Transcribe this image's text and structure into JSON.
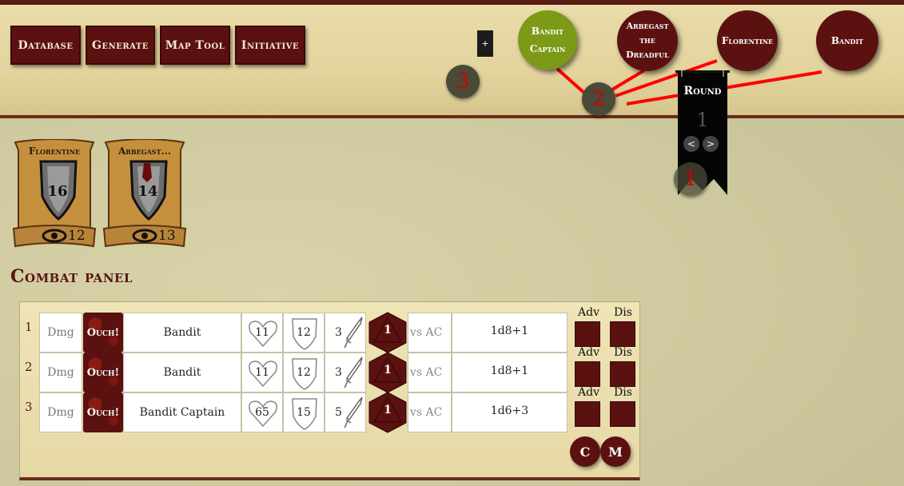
{
  "nav": {
    "database": "Database",
    "generate": "Generate",
    "map_tool": "Map Tool",
    "initiative": "Initiative"
  },
  "add_button": "+",
  "orbs": {
    "a": "3",
    "b": "2",
    "c": "1"
  },
  "tokens": [
    {
      "label": "Bandit Captain",
      "color": "#7d9a17"
    },
    {
      "label": "Arbegast the Dreadful",
      "color": "#5b1110"
    },
    {
      "label": "Florentine",
      "color": "#5b1110"
    },
    {
      "label": "Bandit",
      "color": "#5b1110"
    }
  ],
  "round": {
    "label": "Round",
    "value": "1",
    "prev": "<",
    "next": ">"
  },
  "players": [
    {
      "name": "Florentine",
      "ac": "16",
      "perception": "12"
    },
    {
      "name": "Arbegast...",
      "ac": "14",
      "perception": "13"
    }
  ],
  "combat_title": "Combat panel",
  "rows": [
    {
      "num": "1",
      "dmg": "Dmg",
      "ouch": "Ouch!",
      "name": "Bandit",
      "hp": "11",
      "ac": "12",
      "atk": "3",
      "die": "1",
      "vs": "vs AC",
      "dmg_roll": "1d8+1"
    },
    {
      "num": "2",
      "dmg": "Dmg",
      "ouch": "Ouch!",
      "name": "Bandit",
      "hp": "11",
      "ac": "12",
      "atk": "3",
      "die": "1",
      "vs": "vs AC",
      "dmg_roll": "1d8+1"
    },
    {
      "num": "3",
      "dmg": "Dmg",
      "ouch": "Ouch!",
      "name": "Bandit Captain",
      "hp": "65",
      "ac": "15",
      "atk": "5",
      "die": "1",
      "vs": "vs AC",
      "dmg_roll": "1d6+3"
    }
  ],
  "adv": {
    "adv": "Adv",
    "dis": "Dis"
  },
  "buttons": {
    "c": "C",
    "m": "M"
  }
}
